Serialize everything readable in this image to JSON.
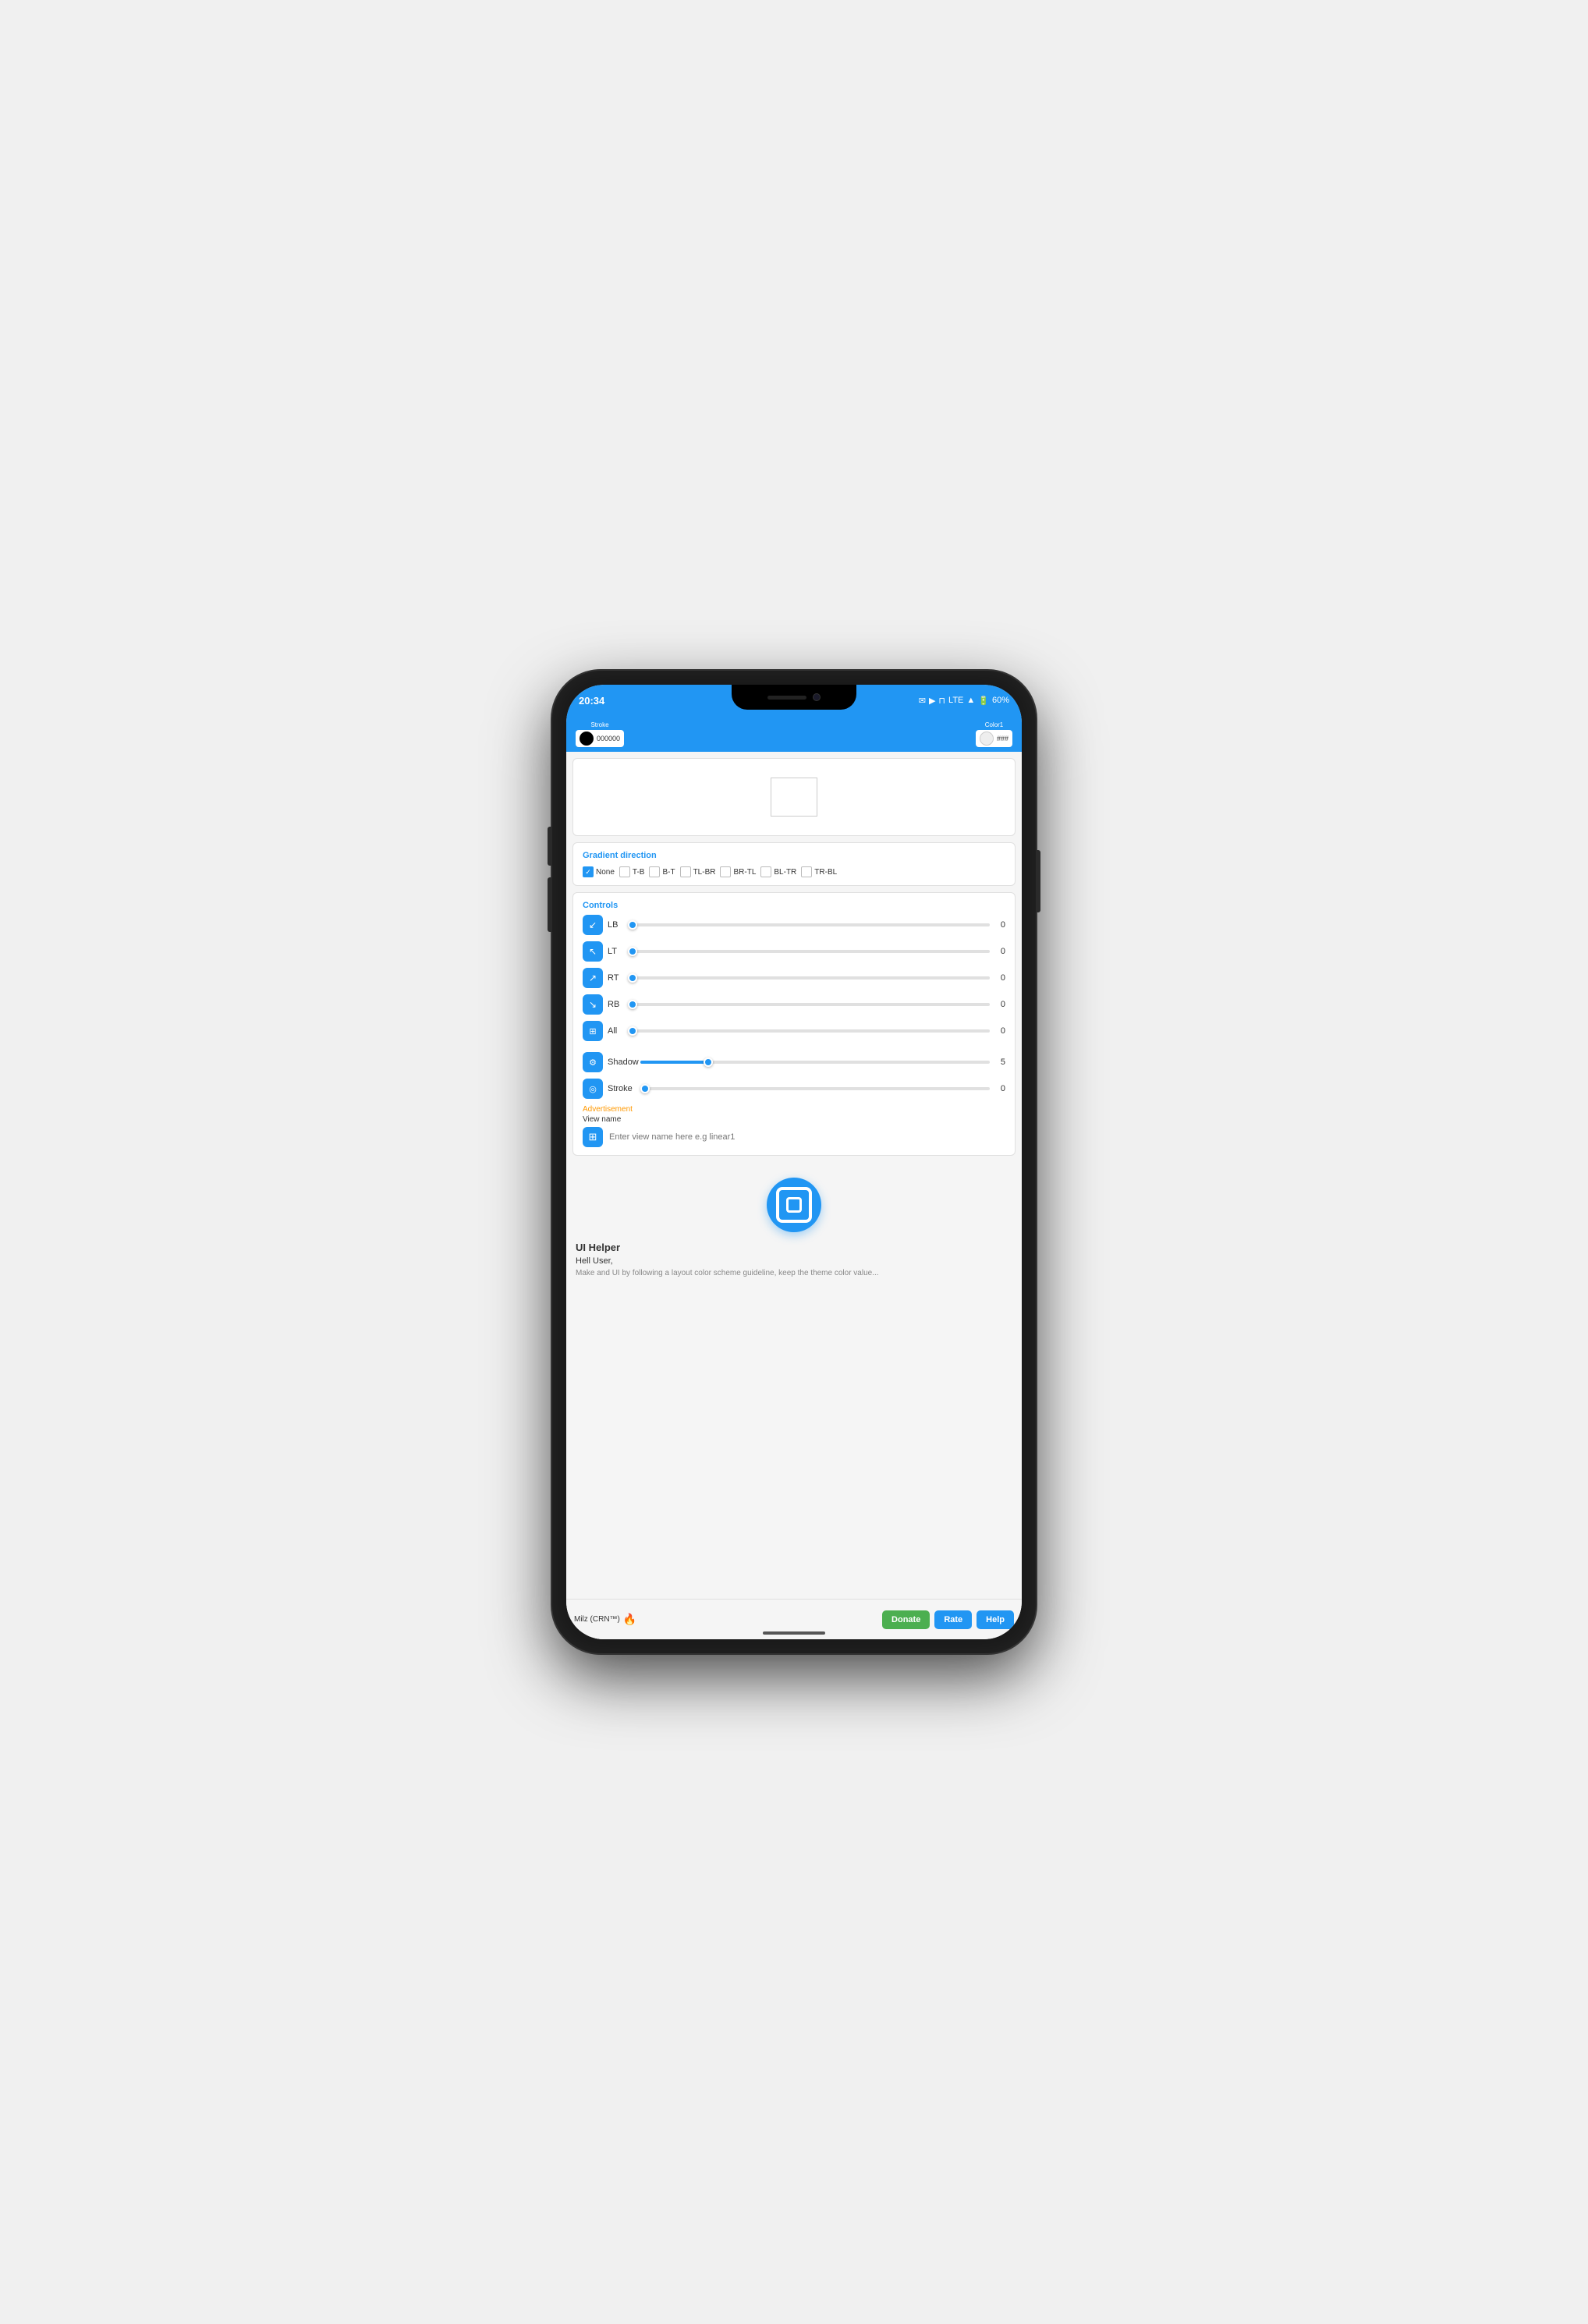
{
  "phone": {
    "status_bar": {
      "time": "20:34",
      "network": "LTE",
      "battery": "60%",
      "icons": [
        "msg-icon",
        "play-icon",
        "cast-icon"
      ]
    },
    "app_bar": {
      "stroke_label": "Stroke",
      "stroke_color": "000000",
      "color1_label": "Color1",
      "color1_hex": "###"
    },
    "gradient_direction": {
      "section_label": "Gradient direction",
      "options": [
        {
          "id": "none",
          "label": "None",
          "checked": true
        },
        {
          "id": "tb",
          "label": "T-B",
          "checked": false
        },
        {
          "id": "bt",
          "label": "B-T",
          "checked": false
        },
        {
          "id": "tlbr",
          "label": "TL-BR",
          "checked": false
        },
        {
          "id": "brtl",
          "label": "BR-TL",
          "checked": false
        },
        {
          "id": "bltr",
          "label": "BL-TR",
          "checked": false
        },
        {
          "id": "trbl",
          "label": "TR-BL",
          "checked": false
        }
      ]
    },
    "controls": {
      "section_label": "Controls",
      "sliders": [
        {
          "id": "lb",
          "icon": "↙",
          "label": "LB",
          "value": 0,
          "percent": 0
        },
        {
          "id": "lt",
          "icon": "↖",
          "label": "LT",
          "value": 0,
          "percent": 0
        },
        {
          "id": "rt",
          "icon": "↗",
          "label": "RT",
          "value": 0,
          "percent": 0
        },
        {
          "id": "rb",
          "icon": "↘",
          "label": "RB",
          "value": 0,
          "percent": 0
        },
        {
          "id": "all",
          "icon": "⊞",
          "label": "All",
          "value": 0,
          "percent": 0
        },
        {
          "id": "shadow",
          "icon": "⚙",
          "label": "Shadow",
          "value": 5,
          "percent": 20
        },
        {
          "id": "stroke",
          "icon": "◎",
          "label": "Stroke",
          "value": 0,
          "percent": 0
        }
      ]
    },
    "advertisement": {
      "label": "Advertisement"
    },
    "view_name": {
      "label": "View name",
      "placeholder": "Enter view name here e.g linear1"
    },
    "logo": {
      "alt": "UI Helper Logo"
    },
    "ui_helper": {
      "title": "UI Helper",
      "greeting": "Hell User,",
      "description": "Make and UI by following a layout color scheme guideline, keep the theme color value..."
    },
    "footer": {
      "brand": "Milz (CRN™)",
      "fire_emoji": "🔥",
      "donate_label": "Donate",
      "rate_label": "Rate",
      "help_label": "Help"
    }
  }
}
